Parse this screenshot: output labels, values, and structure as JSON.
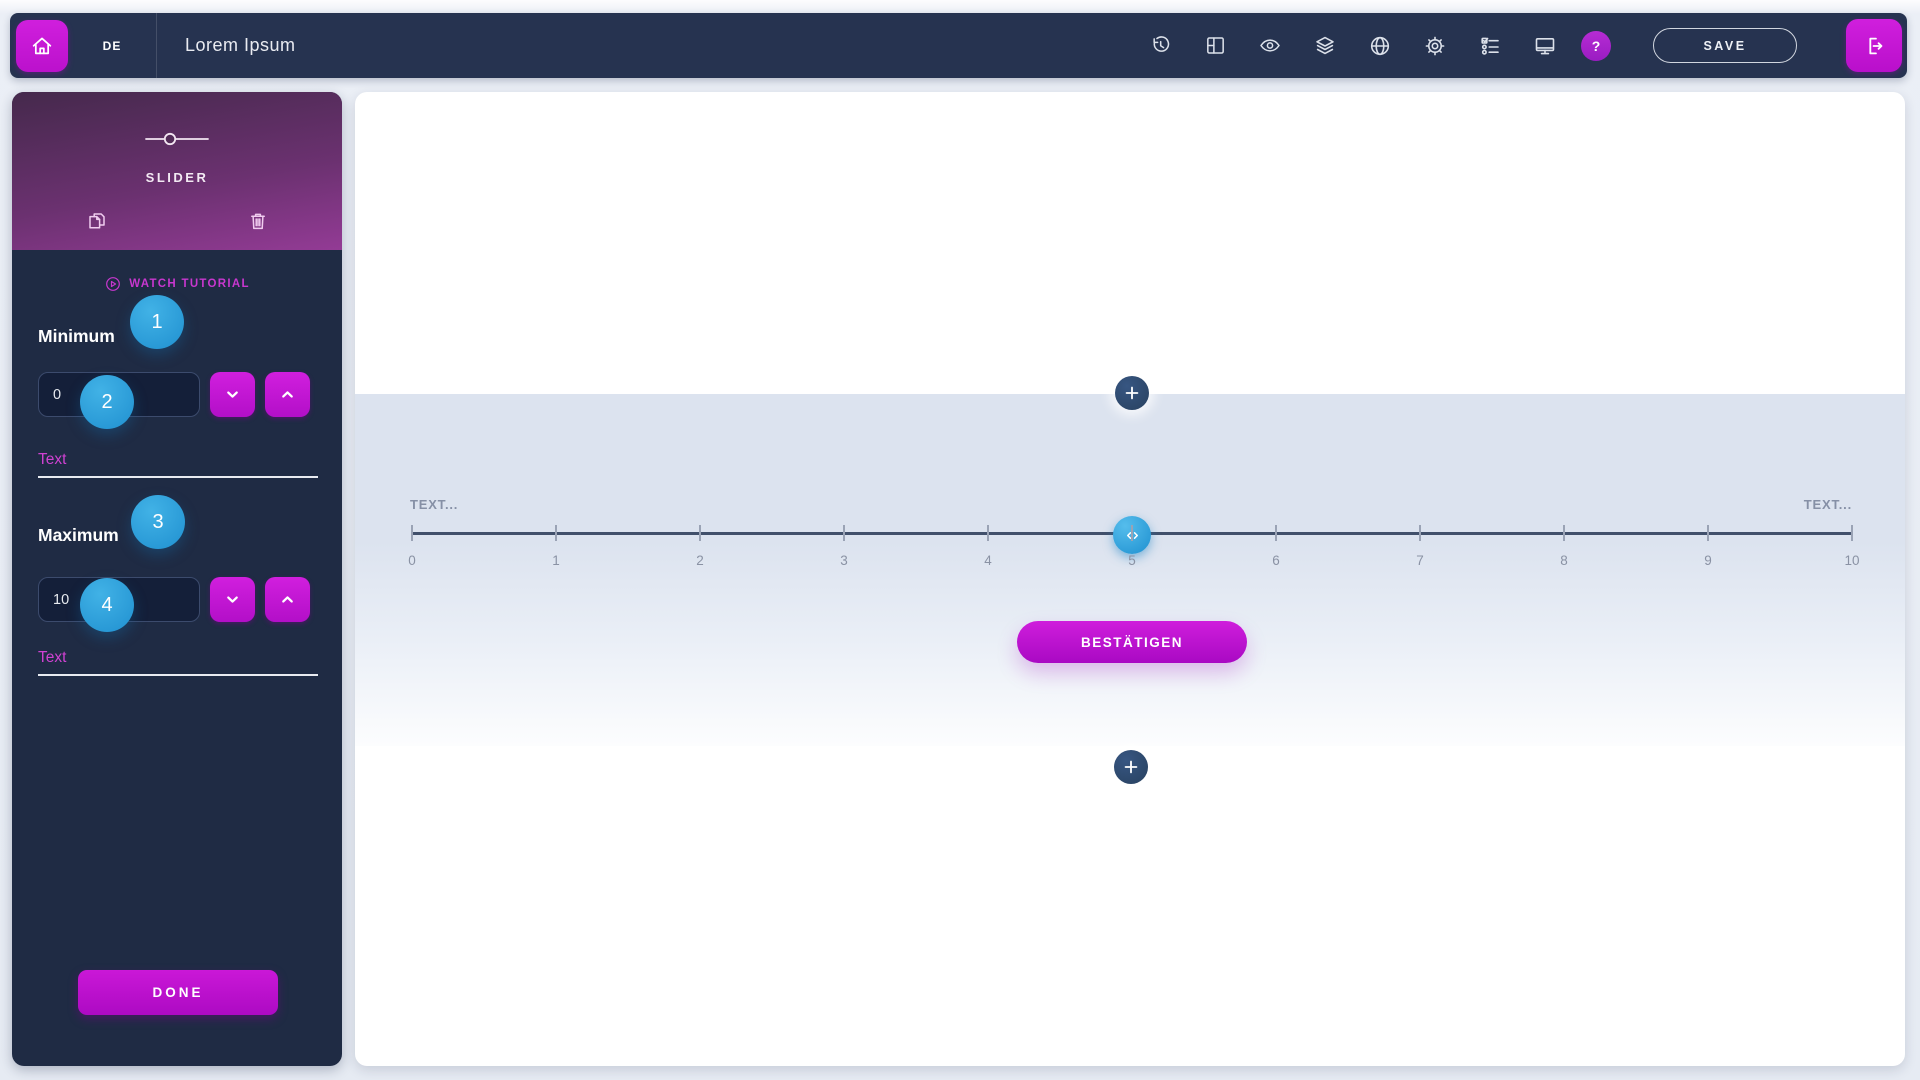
{
  "navbar": {
    "locale": "DE",
    "title": "Lorem Ipsum",
    "save_label": "SAVE",
    "help_label": "?",
    "icon_names": [
      "history",
      "layout",
      "preview-eye",
      "layers",
      "globe",
      "settings",
      "checklist",
      "display",
      "help",
      "logout",
      "home"
    ]
  },
  "sidebar": {
    "widget_label": "SLIDER",
    "watch_tutorial_label": "WATCH TUTORIAL",
    "minimum": {
      "label": "Minimum",
      "badge": "1",
      "value": "0",
      "value_badge": "2",
      "text_placeholder": "Text"
    },
    "maximum": {
      "label": "Maximum",
      "badge": "3",
      "value": "10",
      "value_badge": "4",
      "text_placeholder": "Text"
    },
    "done_label": "DONE"
  },
  "canvas": {
    "left_label": "TEXT...",
    "right_label": "TEXT...",
    "confirm_label": "BESTÄTIGEN",
    "slider": {
      "min": 0,
      "max": 10,
      "value": 5,
      "tick_labels": [
        "0",
        "1",
        "2",
        "3",
        "4",
        "5",
        "6",
        "7",
        "8",
        "9",
        "10"
      ]
    }
  },
  "colors": {
    "accent_magenta": "#c316d6",
    "accent_magenta_dark": "#a50bc0",
    "accent_blue": "#2b9fd9",
    "navbar_bg": "#263350",
    "sidebar_bg": "#1f2b44",
    "band_bg": "#dce3ef",
    "track": "#41506b"
  }
}
